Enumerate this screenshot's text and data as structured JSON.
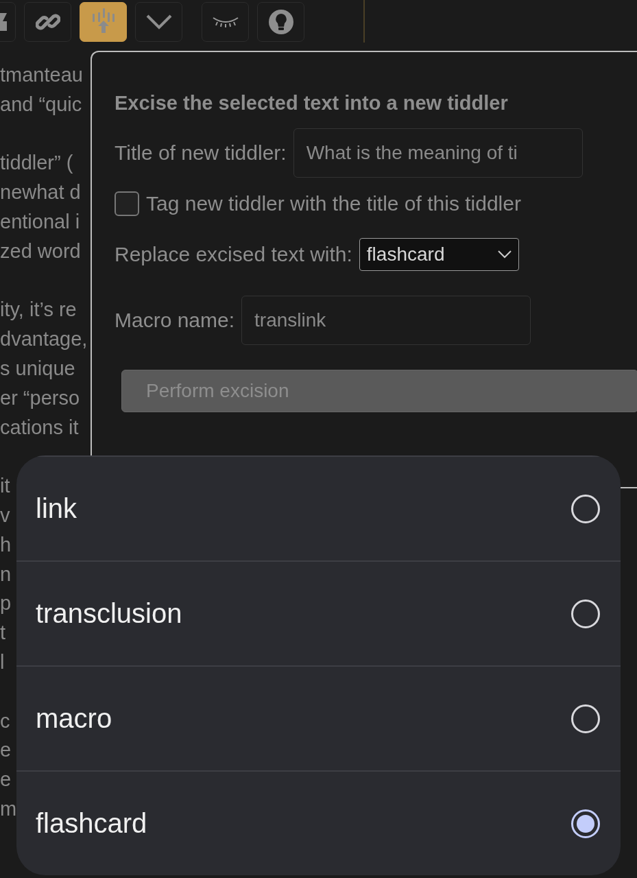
{
  "toolbar": {
    "buttons": [
      {
        "selected": false
      },
      {
        "selected": false
      },
      {
        "selected": true
      },
      {
        "selected": false
      },
      {
        "selected": false
      },
      {
        "selected": false
      }
    ]
  },
  "document": {
    "paragraphs": [
      {
        "lines": [
          "tmanteau",
          "and “quic"
        ]
      },
      {
        "lines": [
          "tiddler” (",
          "newhat d",
          "entional i",
          "zed word"
        ]
      },
      {
        "lines": [
          "ity, it’s re",
          "dvantage,",
          "s unique",
          "er “perso",
          "cations it"
        ]
      },
      {
        "lines": [
          "it",
          "v",
          "h",
          "n",
          "p",
          "t",
          "l"
        ]
      },
      {
        "lines": [
          "c",
          "e",
          "e",
          "m"
        ]
      }
    ]
  },
  "dialog": {
    "heading": "Excise the selected text into a new tiddler",
    "title_label": "Title of new tiddler:",
    "title_value": "What is the meaning of ti",
    "tag_option": {
      "label": "Tag new tiddler with the title of this tiddler",
      "checked": false
    },
    "replace_label": "Replace excised text with:",
    "replace_value": "flashcard",
    "macro_label": "Macro name:",
    "macro_value": "translink",
    "perform_button": {
      "label": "Perform excision",
      "disabled": true
    }
  },
  "picker": {
    "options": [
      {
        "label": "link",
        "selected": false
      },
      {
        "label": "transclusion",
        "selected": false
      },
      {
        "label": "macro",
        "selected": false
      },
      {
        "label": "flashcard",
        "selected": true
      }
    ]
  }
}
